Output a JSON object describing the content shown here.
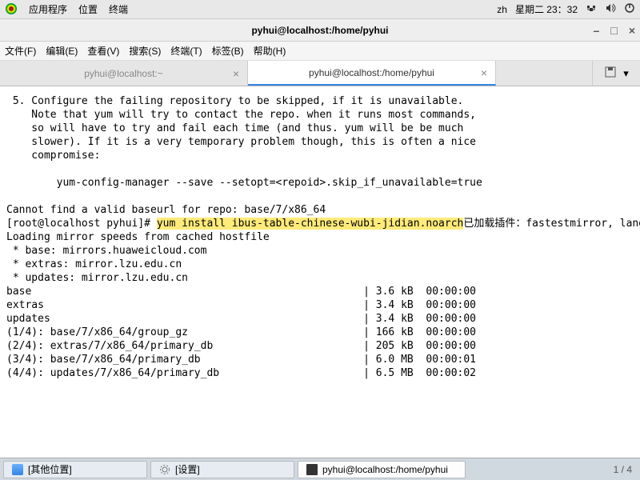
{
  "panel": {
    "apps": "应用程序",
    "places": "位置",
    "terminal": "终端",
    "lang": "zh",
    "datetime": "星期二 23：32"
  },
  "window": {
    "title": "pyhui@localhost:/home/pyhui"
  },
  "menu": {
    "file": "文件(F)",
    "edit": "编辑(E)",
    "view": "查看(V)",
    "search": "搜索(S)",
    "terminal": "终端(T)",
    "tabs": "标签(B)",
    "help": "帮助(H)"
  },
  "tabs": {
    "t1": "pyhui@localhost:~",
    "t2": "pyhui@localhost:/home/pyhui"
  },
  "term": {
    "l1": " 5. Configure the failing repository to be skipped, if it is unavailable.",
    "l2": "    Note that yum will try to contact the repo. when it runs most commands,",
    "l3": "    so will have to try and fail each time (and thus. yum will be be much",
    "l4": "    slower). If it is a very temporary problem though, this is often a nice",
    "l5": "    compromise:",
    "l6": "",
    "l7": "        yum-config-manager --save --setopt=<repoid>.skip_if_unavailable=true",
    "l8": "",
    "l9": "Cannot find a valid baseurl for repo: base/7/x86_64",
    "l10p": "[root@localhost pyhui]# ",
    "l10c": "yum install ibus-table-chinese-wubi-jidian.noarch",
    "l11": "已加载插件：fastestmirror, langpacks",
    "l12": "Loading mirror speeds from cached hostfile",
    "l13": " * base: mirrors.huaweicloud.com",
    "l14": " * extras: mirror.lzu.edu.cn",
    "l15": " * updates: mirror.lzu.edu.cn",
    "l16": "base                                                     | 3.6 kB  00:00:00",
    "l17": "extras                                                   | 3.4 kB  00:00:00",
    "l18": "updates                                                  | 3.4 kB  00:00:00",
    "l19": "(1/4): base/7/x86_64/group_gz                            | 166 kB  00:00:00",
    "l20": "(2/4): extras/7/x86_64/primary_db                        | 205 kB  00:00:00",
    "l21": "(3/4): base/7/x86_64/primary_db                          | 6.0 MB  00:00:01",
    "l22": "(4/4): updates/7/x86_64/primary_db                       | 6.5 MB  00:00:02"
  },
  "taskbar": {
    "t1": "[其他位置]",
    "t2": "[设置]",
    "t3": "pyhui@localhost:/home/pyhui",
    "page": "1 / 4"
  }
}
